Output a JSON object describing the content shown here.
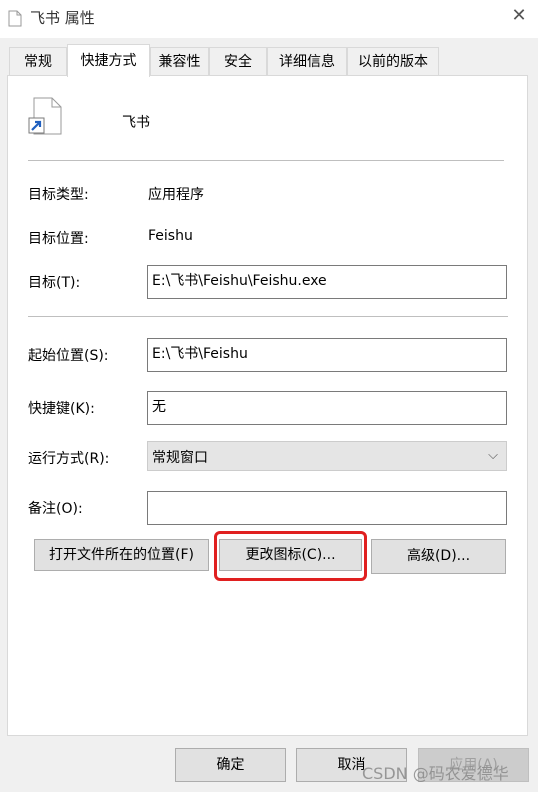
{
  "window": {
    "title": "飞书 属性",
    "close_icon": "close-icon"
  },
  "tabs": [
    {
      "label": "常规"
    },
    {
      "label": "快捷方式"
    },
    {
      "label": "兼容性"
    },
    {
      "label": "安全"
    },
    {
      "label": "详细信息"
    },
    {
      "label": "以前的版本"
    }
  ],
  "shortcut": {
    "name": "飞书",
    "target_type_label": "目标类型:",
    "target_type_value": "应用程序",
    "target_location_label": "目标位置:",
    "target_location_value": "Feishu",
    "target_label": "目标(T):",
    "target_value": "E:\\飞书\\Feishu\\Feishu.exe",
    "start_in_label": "起始位置(S):",
    "start_in_value": "E:\\飞书\\Feishu",
    "hotkey_label": "快捷键(K):",
    "hotkey_value": "无",
    "run_label": "运行方式(R):",
    "run_value": "常规窗口",
    "comment_label": "备注(O):",
    "comment_value": "",
    "open_location_label": "打开文件所在的位置(F)",
    "change_icon_label": "更改图标(C)...",
    "advanced_label": "高级(D)..."
  },
  "footer": {
    "ok_label": "确定",
    "cancel_label": "取消",
    "apply_label": "应用(A)"
  },
  "watermark": "CSDN @码农爱德华",
  "colors": {
    "highlight": "#e02020",
    "tab_active_bg": "#ffffff",
    "window_bg": "#f0f0f0"
  }
}
